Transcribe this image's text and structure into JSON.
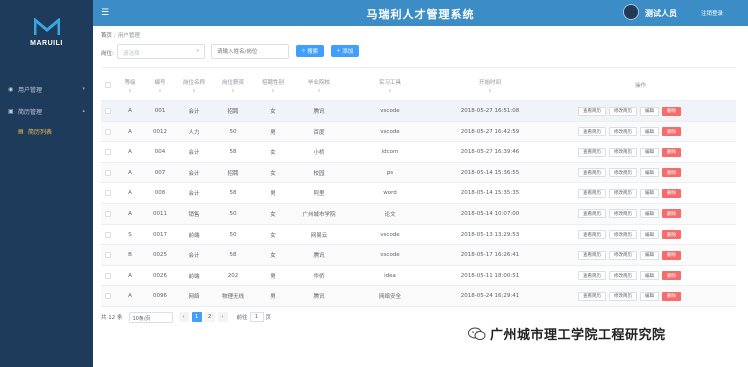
{
  "app": {
    "title": "马瑞利人才管理系统"
  },
  "sidebar": {
    "logo_text": "MARUILI",
    "items": [
      {
        "label": "用户管理",
        "icon": "user-icon"
      },
      {
        "label": "简历管理",
        "icon": "document-icon"
      },
      {
        "label": "简历列表",
        "icon": "list-icon"
      }
    ]
  },
  "header": {
    "user_name": "测试人员",
    "logout": "注销登录"
  },
  "breadcrumb": {
    "home": "首页",
    "current": "用户管理"
  },
  "toolbar": {
    "filter_label": "岗位:",
    "select_placeholder": "请选择",
    "search_placeholder": "请输入姓名/岗位",
    "search_button": "搜索",
    "add_button": "添加"
  },
  "table": {
    "columns": [
      "等级",
      "编号",
      "岗位名称",
      "岗位薪资",
      "招聘性别",
      "毕业院校",
      "实习工具",
      "开始时间",
      "操作"
    ],
    "rows": [
      {
        "level": "A",
        "id": "001",
        "post": "会计",
        "salary": "招聘",
        "gender": "女",
        "school": "腾讯",
        "tool": "vscode",
        "time": "2018-05-27 16:51:08"
      },
      {
        "level": "A",
        "id": "0012",
        "post": "人力",
        "salary": "50",
        "gender": "男",
        "school": "百度",
        "tool": "vscode",
        "time": "2018-05-27 16:42:59"
      },
      {
        "level": "A",
        "id": "004",
        "post": "会计",
        "salary": "58",
        "gender": "女",
        "school": "小桥",
        "tool": "idcom",
        "time": "2018-05-27 16:39:46"
      },
      {
        "level": "A",
        "id": "007",
        "post": "会计",
        "salary": "招聘",
        "gender": "女",
        "school": "校园",
        "tool": "ps",
        "time": "2018-05-14 15:36:55"
      },
      {
        "level": "A",
        "id": "008",
        "post": "会计",
        "salary": "58",
        "gender": "男",
        "school": "阿里",
        "tool": "word",
        "time": "2018-05-14 15:35:35"
      },
      {
        "level": "A",
        "id": "0011",
        "post": "销售",
        "salary": "50",
        "gender": "女",
        "school": "广州城市学院",
        "tool": "论文",
        "time": "2018-05-14 10:07:00"
      },
      {
        "level": "S",
        "id": "0017",
        "post": "前端",
        "salary": "50",
        "gender": "女",
        "school": "网易云",
        "tool": "vscode",
        "time": "2018-05-13 13:29:53"
      },
      {
        "level": "B",
        "id": "0025",
        "post": "会计",
        "salary": "58",
        "gender": "女",
        "school": "腾讯",
        "tool": "vscode",
        "time": "2018-05-17 16:26:41"
      },
      {
        "level": "A",
        "id": "0026",
        "post": "前端",
        "salary": "202",
        "gender": "男",
        "school": "华侨",
        "tool": "idea",
        "time": "2018-05-11 18:00:51"
      },
      {
        "level": "A",
        "id": "0096",
        "post": "网络",
        "salary": "物理无线",
        "gender": "男",
        "school": "腾讯",
        "tool": "网络安全",
        "time": "2018-05-24 16:29:41"
      }
    ],
    "actions": {
      "view_resume": "查看简历",
      "edit_resume": "修改简历",
      "edit": "编辑",
      "delete": "删除"
    }
  },
  "pagination": {
    "total": "共 12 条",
    "page_size": "10条/页",
    "pages": [
      "1",
      "2"
    ],
    "current": "1",
    "goto_label": "前往",
    "goto_value": "1",
    "goto_suffix": "页"
  },
  "watermark": {
    "text": "广州城市理工学院工程研究院"
  }
}
